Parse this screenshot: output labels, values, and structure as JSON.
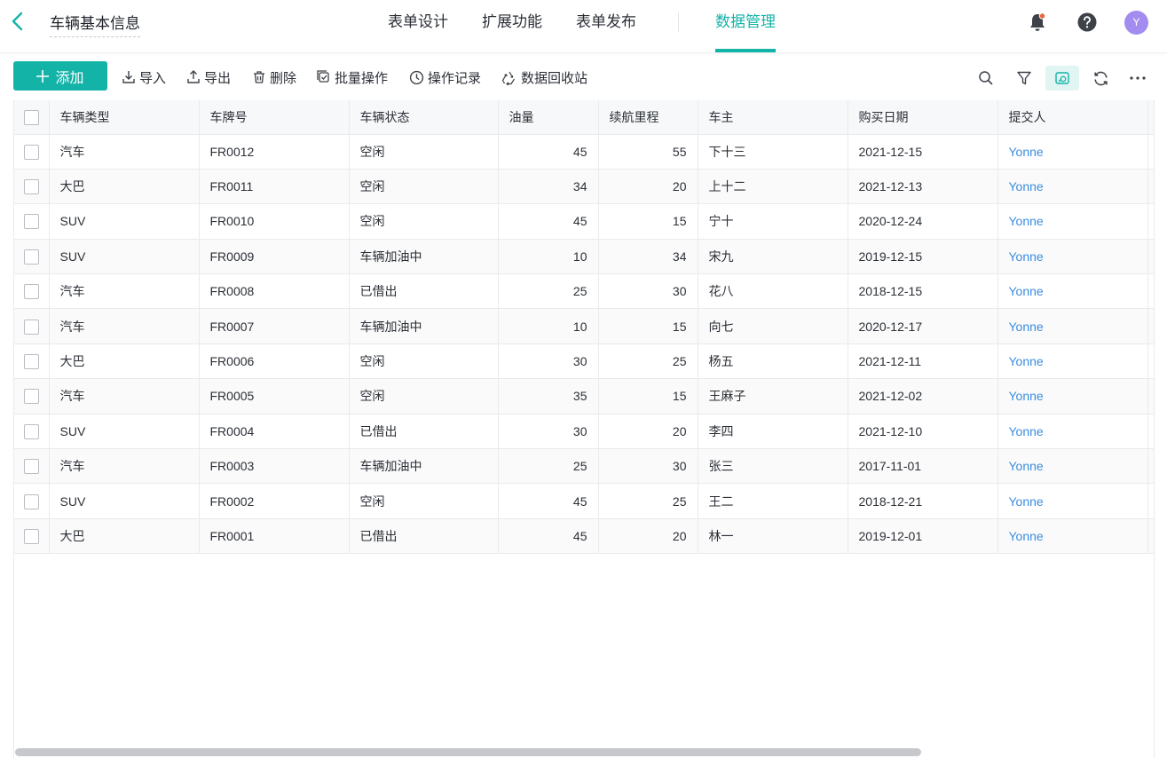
{
  "header": {
    "form_title": "车辆基本信息",
    "nav": [
      "表单设计",
      "扩展功能",
      "表单发布",
      "数据管理"
    ],
    "active_nav": "数据管理",
    "avatar_initial": "Y"
  },
  "toolbar": {
    "add_label": "添加",
    "import_label": "导入",
    "export_label": "导出",
    "delete_label": "删除",
    "batch_label": "批量操作",
    "log_label": "操作记录",
    "recycle_label": "数据回收站",
    "right_icons": [
      "search-icon",
      "filter-icon",
      "view-toggle-icon",
      "refresh-icon",
      "more-icon"
    ]
  },
  "table": {
    "columns": [
      "车辆类型",
      "车牌号",
      "车辆状态",
      "油量",
      "续航里程",
      "车主",
      "购买日期",
      "提交人"
    ],
    "rows": [
      [
        "汽车",
        "FR0012",
        "空闲",
        "45",
        "55",
        "下十三",
        "2021-12-15",
        "Yonne"
      ],
      [
        "大巴",
        "FR0011",
        "空闲",
        "34",
        "20",
        "上十二",
        "2021-12-13",
        "Yonne"
      ],
      [
        "SUV",
        "FR0010",
        "空闲",
        "45",
        "15",
        "宁十",
        "2020-12-24",
        "Yonne"
      ],
      [
        "SUV",
        "FR0009",
        "车辆加油中",
        "10",
        "34",
        "宋九",
        "2019-12-15",
        "Yonne"
      ],
      [
        "汽车",
        "FR0008",
        "已借出",
        "25",
        "30",
        "花八",
        "2018-12-15",
        "Yonne"
      ],
      [
        "汽车",
        "FR0007",
        "车辆加油中",
        "10",
        "15",
        "向七",
        "2020-12-17",
        "Yonne"
      ],
      [
        "大巴",
        "FR0006",
        "空闲",
        "30",
        "25",
        "杨五",
        "2021-12-11",
        "Yonne"
      ],
      [
        "汽车",
        "FR0005",
        "空闲",
        "35",
        "15",
        "王麻子",
        "2021-12-02",
        "Yonne"
      ],
      [
        "SUV",
        "FR0004",
        "已借出",
        "30",
        "20",
        "李四",
        "2021-12-10",
        "Yonne"
      ],
      [
        "汽车",
        "FR0003",
        "车辆加油中",
        "25",
        "30",
        "张三",
        "2017-11-01",
        "Yonne"
      ],
      [
        "SUV",
        "FR0002",
        "空闲",
        "45",
        "25",
        "王二",
        "2018-12-21",
        "Yonne"
      ],
      [
        "大巴",
        "FR0001",
        "已借出",
        "45",
        "20",
        "林一",
        "2019-12-01",
        "Yonne"
      ]
    ]
  },
  "colors": {
    "accent": "#14b3a8",
    "link": "#3c8dde",
    "avatar": "#a38cf0",
    "bell_dot": "#e8663d"
  }
}
